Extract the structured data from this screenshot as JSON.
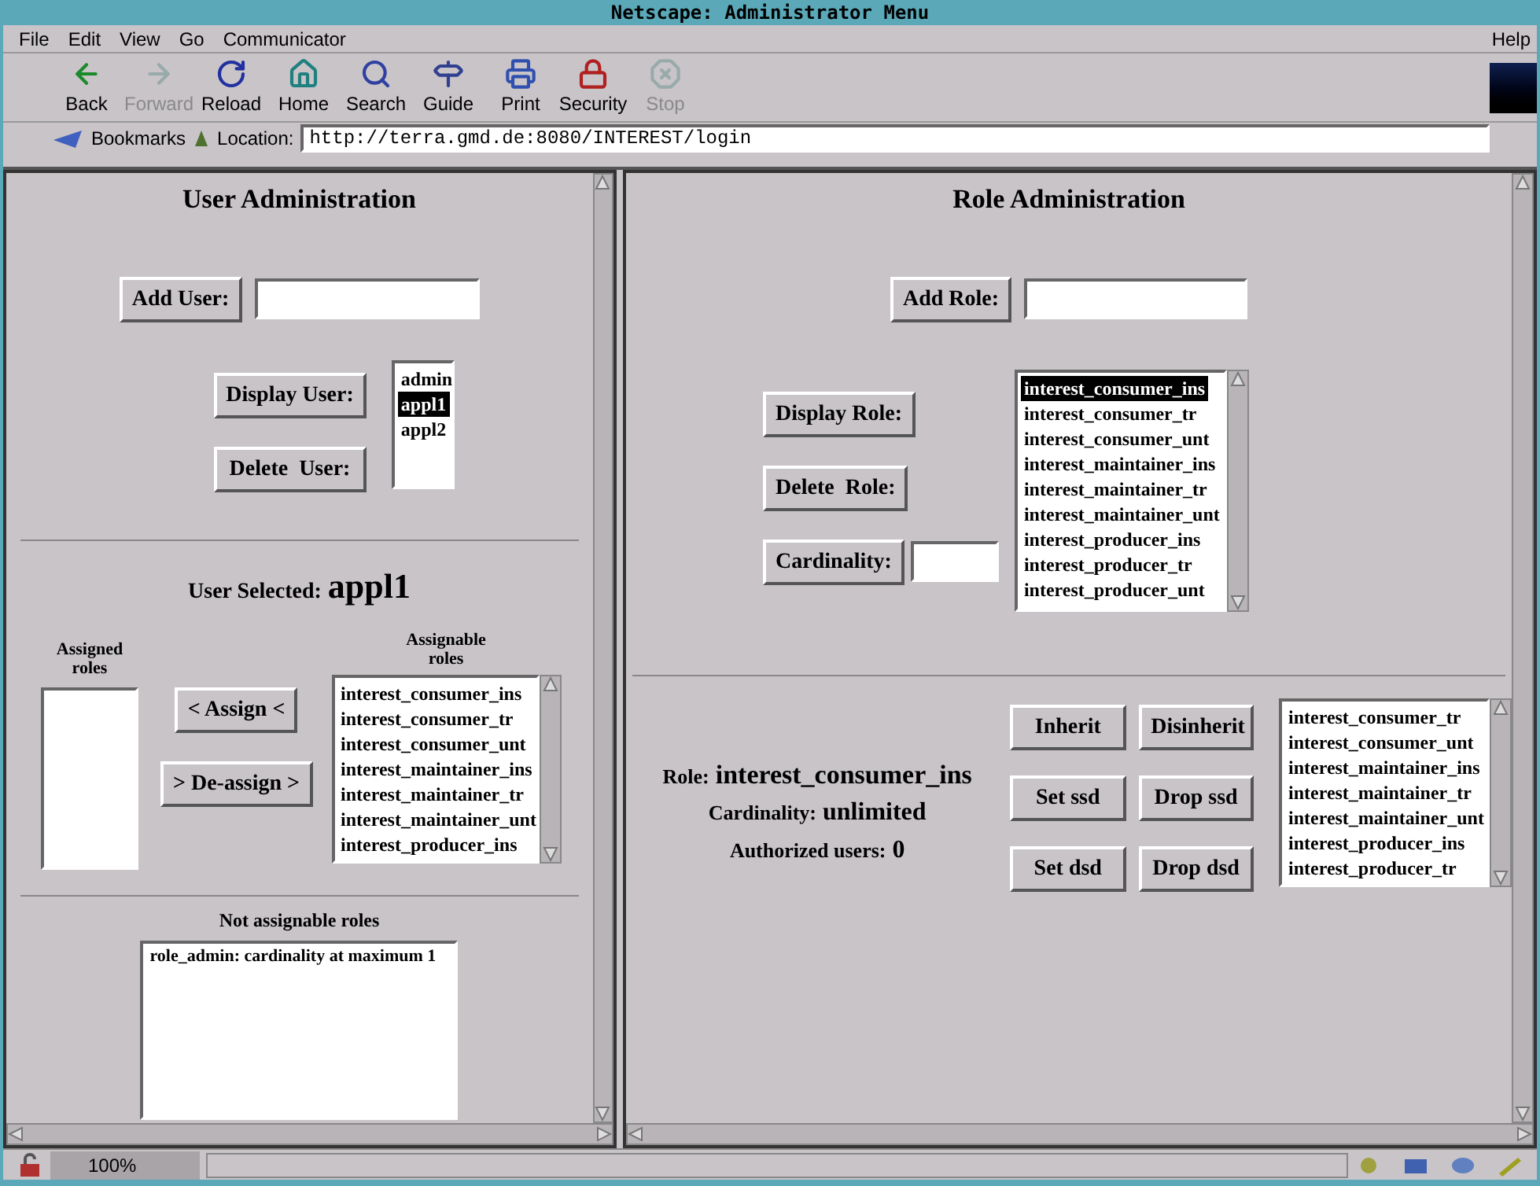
{
  "window": {
    "title": "Netscape: Administrator Menu"
  },
  "menu": [
    "File",
    "Edit",
    "View",
    "Go",
    "Communicator"
  ],
  "help": "Help",
  "toolbar": [
    {
      "label": "Back",
      "disabled": false
    },
    {
      "label": "Forward",
      "disabled": true
    },
    {
      "label": "Reload",
      "disabled": false
    },
    {
      "label": "Home",
      "disabled": false
    },
    {
      "label": "Search",
      "disabled": false
    },
    {
      "label": "Guide",
      "disabled": false
    },
    {
      "label": "Print",
      "disabled": false
    },
    {
      "label": "Security",
      "disabled": false
    },
    {
      "label": "Stop",
      "disabled": true
    }
  ],
  "location": {
    "bookmarks": "Bookmarks",
    "label": "Location:",
    "url": "http://terra.gmd.de:8080/INTEREST/login"
  },
  "user_admin": {
    "title": "User Administration",
    "add_button": "Add User:",
    "display_button": "Display User:",
    "delete_button": "Delete  User:",
    "users": [
      {
        "label": "admin",
        "selected": false
      },
      {
        "label": "appl1",
        "selected": true
      },
      {
        "label": "appl2",
        "selected": false
      }
    ],
    "selected_label": "User Selected:",
    "selected_user": "appl1",
    "assigned_heading": "Assigned roles",
    "assignable_heading": "Assignable roles",
    "assign_button": "< Assign <",
    "deassign_button": "> De-assign >",
    "assignable": [
      "interest_consumer_ins",
      "interest_consumer_tr",
      "interest_consumer_unt",
      "interest_maintainer_ins",
      "interest_maintainer_tr",
      "interest_maintainer_unt",
      "interest_producer_ins"
    ],
    "not_assignable_heading": "Not assignable roles",
    "not_assignable": [
      "role_admin: cardinality at maximum 1"
    ]
  },
  "role_admin": {
    "title": "Role Administration",
    "add_button": "Add Role:",
    "display_button": "Display Role:",
    "delete_button": "Delete  Role:",
    "cardinality_button": "Cardinality:",
    "roles": [
      {
        "label": "interest_consumer_ins",
        "selected": true
      },
      {
        "label": "interest_consumer_tr",
        "selected": false
      },
      {
        "label": "interest_consumer_unt",
        "selected": false
      },
      {
        "label": "interest_maintainer_ins",
        "selected": false
      },
      {
        "label": "interest_maintainer_tr",
        "selected": false
      },
      {
        "label": "interest_maintainer_unt",
        "selected": false
      },
      {
        "label": "interest_producer_ins",
        "selected": false
      },
      {
        "label": "interest_producer_tr",
        "selected": false
      },
      {
        "label": "interest_producer_unt",
        "selected": false
      }
    ],
    "role_label": "Role:",
    "role_value": "interest_consumer_ins",
    "cardinality_label": "Cardinality:",
    "cardinality_value": "unlimited",
    "authorized_label": "Authorized users:",
    "authorized_value": "0",
    "buttons": [
      "Inherit",
      "Disinherit",
      "Set ssd",
      "Drop ssd",
      "Set dsd",
      "Drop dsd"
    ],
    "inherit_roles": [
      "interest_consumer_tr",
      "interest_consumer_unt",
      "interest_maintainer_ins",
      "interest_maintainer_tr",
      "interest_maintainer_unt",
      "interest_producer_ins",
      "interest_producer_tr"
    ]
  },
  "status": {
    "zoom": "100%"
  }
}
